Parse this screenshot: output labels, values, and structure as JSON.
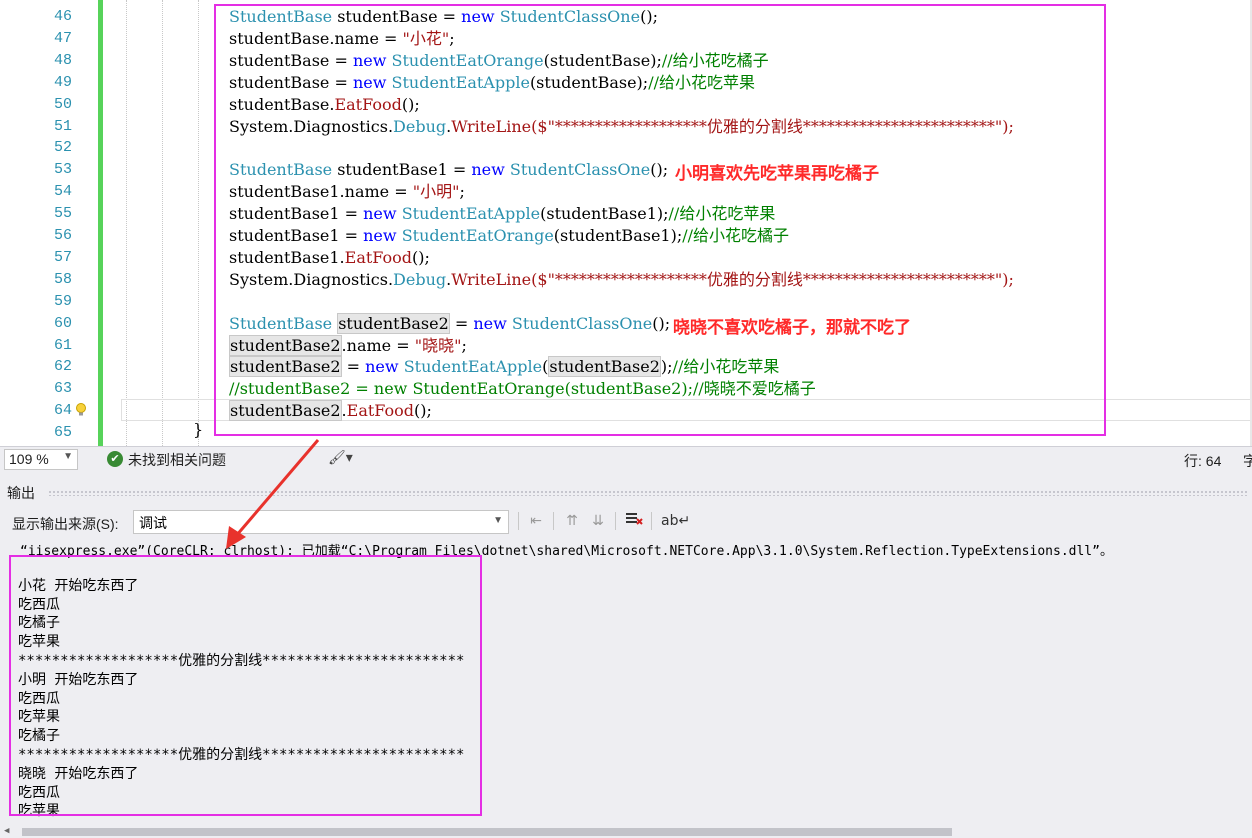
{
  "editor": {
    "line_numbers": [
      "46",
      "47",
      "48",
      "49",
      "50",
      "51",
      "52",
      "53",
      "54",
      "55",
      "56",
      "57",
      "58",
      "59",
      "60",
      "61",
      "62",
      "63",
      "64",
      "65"
    ],
    "code": [
      [
        {
          "t": "StudentBase",
          "c": "ty"
        },
        {
          "t": " studentBase = ",
          "c": ""
        },
        {
          "t": "new",
          "c": "kw"
        },
        {
          "t": " ",
          "c": ""
        },
        {
          "t": "StudentClassOne",
          "c": "ty"
        },
        {
          "t": "();",
          "c": ""
        }
      ],
      [
        {
          "t": "studentBase.name = ",
          "c": ""
        },
        {
          "t": "\"小花\"",
          "c": "st"
        },
        {
          "t": ";",
          "c": ""
        }
      ],
      [
        {
          "t": "studentBase = ",
          "c": ""
        },
        {
          "t": "new",
          "c": "kw"
        },
        {
          "t": " ",
          "c": ""
        },
        {
          "t": "StudentEatOrange",
          "c": "ty"
        },
        {
          "t": "(studentBase);",
          "c": ""
        },
        {
          "t": "//给小花吃橘子",
          "c": "cm"
        }
      ],
      [
        {
          "t": "studentBase = ",
          "c": ""
        },
        {
          "t": "new",
          "c": "kw"
        },
        {
          "t": " ",
          "c": ""
        },
        {
          "t": "StudentEatApple",
          "c": "ty"
        },
        {
          "t": "(studentBase);",
          "c": ""
        },
        {
          "t": "//给小花吃苹果",
          "c": "cm"
        }
      ],
      [
        {
          "t": "studentBase.",
          "c": ""
        },
        {
          "t": "EatFood",
          "c": "st"
        },
        {
          "t": "();",
          "c": ""
        }
      ],
      [
        {
          "t": "System.Diagnostics.",
          "c": ""
        },
        {
          "t": "Debug",
          "c": "ty"
        },
        {
          "t": ".",
          "c": ""
        },
        {
          "t": "WriteLine",
          "c": "st"
        },
        {
          "t": "($\"*******************优雅的分割线************************\");",
          "c": "st"
        }
      ],
      [],
      [
        {
          "t": "StudentBase",
          "c": "ty"
        },
        {
          "t": " studentBase1 = ",
          "c": ""
        },
        {
          "t": "new",
          "c": "kw"
        },
        {
          "t": " ",
          "c": ""
        },
        {
          "t": "StudentClassOne",
          "c": "ty"
        },
        {
          "t": "();",
          "c": ""
        }
      ],
      [
        {
          "t": "studentBase1.name = ",
          "c": ""
        },
        {
          "t": "\"小明\"",
          "c": "st"
        },
        {
          "t": ";",
          "c": ""
        }
      ],
      [
        {
          "t": "studentBase1 = ",
          "c": ""
        },
        {
          "t": "new",
          "c": "kw"
        },
        {
          "t": " ",
          "c": ""
        },
        {
          "t": "StudentEatApple",
          "c": "ty"
        },
        {
          "t": "(studentBase1);",
          "c": ""
        },
        {
          "t": "//给小花吃苹果",
          "c": "cm"
        }
      ],
      [
        {
          "t": "studentBase1 = ",
          "c": ""
        },
        {
          "t": "new",
          "c": "kw"
        },
        {
          "t": " ",
          "c": ""
        },
        {
          "t": "StudentEatOrange",
          "c": "ty"
        },
        {
          "t": "(studentBase1);",
          "c": ""
        },
        {
          "t": "//给小花吃橘子",
          "c": "cm"
        }
      ],
      [
        {
          "t": "studentBase1.",
          "c": ""
        },
        {
          "t": "EatFood",
          "c": "st"
        },
        {
          "t": "();",
          "c": ""
        }
      ],
      [
        {
          "t": "System.Diagnostics.",
          "c": ""
        },
        {
          "t": "Debug",
          "c": "ty"
        },
        {
          "t": ".",
          "c": ""
        },
        {
          "t": "WriteLine",
          "c": "st"
        },
        {
          "t": "($\"*******************优雅的分割线************************\");",
          "c": "st"
        }
      ],
      [],
      [
        {
          "t": "StudentBase",
          "c": "ty"
        },
        {
          "t": " ",
          "c": ""
        },
        {
          "t": "studentBase2",
          "c": "hl"
        },
        {
          "t": " = ",
          "c": ""
        },
        {
          "t": "new",
          "c": "kw"
        },
        {
          "t": " ",
          "c": ""
        },
        {
          "t": "StudentClassOne",
          "c": "ty"
        },
        {
          "t": "();",
          "c": ""
        }
      ],
      [
        {
          "t": "studentBase2",
          "c": "hl"
        },
        {
          "t": ".name = ",
          "c": ""
        },
        {
          "t": "\"晓晓\"",
          "c": "st"
        },
        {
          "t": ";",
          "c": ""
        }
      ],
      [
        {
          "t": "studentBase2",
          "c": "hl"
        },
        {
          "t": " = ",
          "c": ""
        },
        {
          "t": "new",
          "c": "kw"
        },
        {
          "t": " ",
          "c": ""
        },
        {
          "t": "StudentEatApple",
          "c": "ty"
        },
        {
          "t": "(",
          "c": ""
        },
        {
          "t": "studentBase2",
          "c": "hl"
        },
        {
          "t": ");",
          "c": ""
        },
        {
          "t": "//给小花吃苹果",
          "c": "cm"
        }
      ],
      [
        {
          "t": "//studentBase2 = new StudentEatOrange(studentBase2);//晓晓不爱吃橘子",
          "c": "cm"
        }
      ],
      [
        {
          "t": "studentBase2",
          "c": "hl"
        },
        {
          "t": ".",
          "c": ""
        },
        {
          "t": "EatFood",
          "c": "st"
        },
        {
          "t": "();",
          "c": ""
        }
      ],
      []
    ],
    "closing_brace": "}",
    "annotations": {
      "note1": "小明喜欢先吃苹果再吃橘子",
      "note2": "晓晓不喜欢吃橘子，那就不吃了"
    }
  },
  "status": {
    "zoom": "109 %",
    "issues": "未找到相关问题",
    "line": "行: 64",
    "trailing": "字"
  },
  "output": {
    "title": "输出",
    "source_label": "显示输出来源(S):",
    "source_value": "调试",
    "lines": [
      "“iisexpress.exe”(CoreCLR: clrhost): 已加载“C:\\Program Files\\dotnet\\shared\\Microsoft.NETCore.App\\3.1.0\\System.Reflection.TypeExtensions.dll”。",
      "小花 开始吃东西了",
      "吃西瓜",
      "吃橘子",
      "吃苹果",
      "*******************优雅的分割线************************",
      "小明 开始吃东西了",
      "吃西瓜",
      "吃苹果",
      "吃橘子",
      "*******************优雅的分割线************************",
      "晓晓 开始吃东西了",
      "吃西瓜",
      "吃苹果"
    ]
  },
  "colors": {
    "highlight_box": "#e42ee4",
    "arrow": "#e8322c",
    "note_text": "#ff2a2a"
  }
}
